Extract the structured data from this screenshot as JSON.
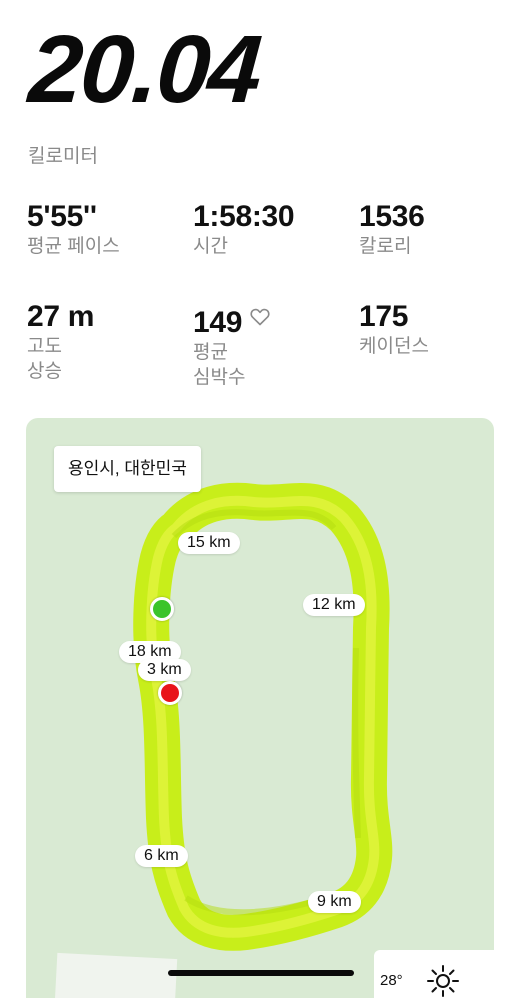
{
  "summary": {
    "distance": "20.04",
    "distance_unit": "킬로미터"
  },
  "stats": {
    "pace": {
      "value": "5'55''",
      "label": "평균 페이스"
    },
    "time": {
      "value": "1:58:30",
      "label": "시간"
    },
    "calories": {
      "value": "1536",
      "label": "칼로리"
    },
    "elevation": {
      "value": "27 m",
      "label_line1": "고도",
      "label_line2": "상승"
    },
    "heart_rate": {
      "value": "149",
      "label_line1": "평균",
      "label_line2": "심박수",
      "icon": "heart-outline-icon"
    },
    "cadence": {
      "value": "175",
      "label": "케이던스"
    }
  },
  "map": {
    "location": "용인시, 대한민국",
    "km_markers": [
      "15 km",
      "12 km",
      "18 km",
      "3 km",
      "6 km",
      "9 km"
    ],
    "start_marker": "start-marker",
    "end_marker": "end-marker",
    "weather": {
      "temp": "28°",
      "icon": "sun-icon"
    }
  },
  "colors": {
    "route": "#c8ee1a",
    "route_highlight": "#e6f545",
    "map_background": "#d9ead3",
    "start": "#3bc42a",
    "end": "#e8141a",
    "label_gray": "#8a8a8a"
  }
}
